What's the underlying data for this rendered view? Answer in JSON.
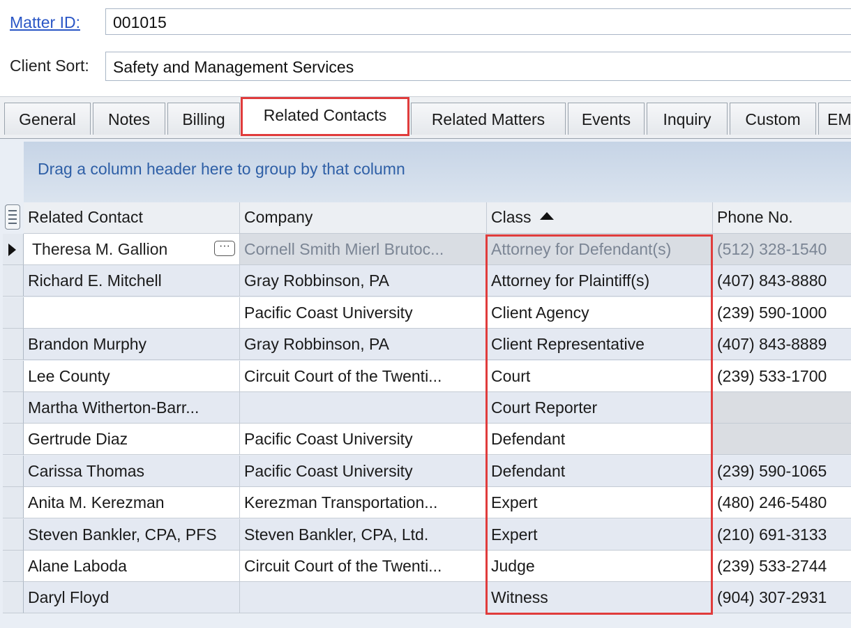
{
  "matter": {
    "label": "Matter ID:",
    "value": "001015"
  },
  "client_sort": {
    "label": "Client Sort:",
    "value": "Safety and Management Services"
  },
  "tabs": [
    {
      "label": "General"
    },
    {
      "label": "Notes"
    },
    {
      "label": "Billing"
    },
    {
      "label": "Related Contacts",
      "active": true
    },
    {
      "label": "Related Matters"
    },
    {
      "label": "Events"
    },
    {
      "label": "Inquiry"
    },
    {
      "label": "Custom"
    },
    {
      "label": "EM"
    }
  ],
  "grid": {
    "group_hint": "Drag a column header here to group by that column",
    "columns": {
      "related_contact": "Related Contact",
      "company": "Company",
      "class": "Class",
      "phone": "Phone No."
    },
    "sort_column": "Class",
    "sort_direction": "ascending",
    "highlight_color": "#e03c3c",
    "rows": [
      {
        "contact": "Theresa M. Gallion",
        "company": "Cornell Smith Mierl Brutoc...",
        "class": "Attorney for Defendant(s)",
        "phone": "(512) 328-1540",
        "selected": true
      },
      {
        "contact": "Richard E. Mitchell",
        "company": "Gray Robbinson, PA",
        "class": "Attorney for Plaintiff(s)",
        "phone": "(407) 843-8880"
      },
      {
        "contact": "",
        "company": "Pacific Coast University",
        "class": "Client Agency",
        "phone": "(239) 590-1000"
      },
      {
        "contact": "Brandon Murphy",
        "company": "Gray Robbinson, PA",
        "class": "Client Representative",
        "phone": "(407) 843-8889"
      },
      {
        "contact": "Lee County",
        "company": "Circuit Court of the Twenti...",
        "class": "Court",
        "phone": "(239) 533-1700"
      },
      {
        "contact": "Martha Witherton-Barr...",
        "company": "",
        "class": "Court Reporter",
        "phone": ""
      },
      {
        "contact": "Gertrude Diaz",
        "company": "Pacific Coast University",
        "class": "Defendant",
        "phone": ""
      },
      {
        "contact": "Carissa Thomas",
        "company": "Pacific Coast University",
        "class": "Defendant",
        "phone": "(239) 590-1065"
      },
      {
        "contact": "Anita M. Kerezman",
        "company": "Kerezman Transportation...",
        "class": "Expert",
        "phone": "(480) 246-5480"
      },
      {
        "contact": "Steven Bankler, CPA, PFS",
        "company": "Steven Bankler, CPA, Ltd.",
        "class": "Expert",
        "phone": "(210) 691-3133"
      },
      {
        "contact": "Alane Laboda",
        "company": "Circuit Court of the Twenti...",
        "class": "Judge",
        "phone": "(239) 533-2744"
      },
      {
        "contact": "Daryl Floyd",
        "company": "",
        "class": "Witness",
        "phone": "(904) 307-2931"
      }
    ]
  }
}
